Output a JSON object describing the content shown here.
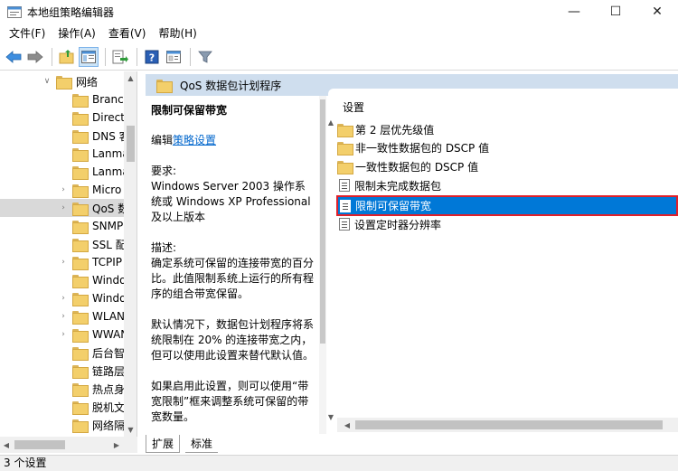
{
  "window": {
    "title": "本地组策略编辑器",
    "minimize_glyph": "—",
    "maximize_glyph": "☐",
    "close_glyph": "✕"
  },
  "menu": [
    {
      "label": "文件(F)"
    },
    {
      "label": "操作(A)"
    },
    {
      "label": "查看(V)"
    },
    {
      "label": "帮助(H)"
    }
  ],
  "toolbar": {
    "icons": [
      "back-arrow-icon",
      "forward-arrow-icon",
      "up-folder-icon",
      "show-hide-tree-icon",
      "export-list-icon",
      "help-icon",
      "properties-icon",
      "filter-icon"
    ]
  },
  "tree": {
    "items": [
      {
        "label": "网络",
        "expanded": true,
        "arrow": "∨"
      },
      {
        "label": "Branch",
        "arrow": ""
      },
      {
        "label": "Direct",
        "arrow": ""
      },
      {
        "label": "DNS 客",
        "arrow": ""
      },
      {
        "label": "Lanma",
        "arrow": ""
      },
      {
        "label": "Lanma",
        "arrow": ""
      },
      {
        "label": "Micro",
        "arrow": "›"
      },
      {
        "label": "QoS 数",
        "arrow": "›",
        "selected": true
      },
      {
        "label": "SNMP",
        "arrow": ""
      },
      {
        "label": "SSL 配",
        "arrow": ""
      },
      {
        "label": "TCPIP",
        "arrow": "›"
      },
      {
        "label": "Windo",
        "arrow": ""
      },
      {
        "label": "Windo",
        "arrow": "›"
      },
      {
        "label": "WLAN",
        "arrow": "›"
      },
      {
        "label": "WWAN",
        "arrow": "›"
      },
      {
        "label": "后台智",
        "arrow": ""
      },
      {
        "label": "链路层",
        "arrow": ""
      },
      {
        "label": "热点身",
        "arrow": ""
      },
      {
        "label": "脱机文",
        "arrow": ""
      },
      {
        "label": "网络隔",
        "arrow": ""
      }
    ]
  },
  "section": {
    "title": "QoS 数据包计划程序"
  },
  "description": {
    "title": "限制可保留带宽",
    "edit_prefix": "编辑",
    "edit_link": "策略设置",
    "requirements_label": "要求:",
    "requirements_text": "Windows Server 2003 操作系统或 Windows XP Professional 及以上版本",
    "desc_label": "描述:",
    "desc_text": "确定系统可保留的连接带宽的百分比。此值限制系统上运行的所有程序的组合带宽保留。",
    "default_text": "默认情况下，数据包计划程序将系统限制在 20% 的连接带宽之内，但可以使用此设置来替代默认值。",
    "enabled_text": "如果启用此设置，则可以使用“带宽限制”框来调整系统可保留的带宽数量。"
  },
  "list": {
    "header": "设置",
    "items": [
      {
        "label": "第 2 层优先级值",
        "type": "folder"
      },
      {
        "label": "非一致性数据包的 DSCP 值",
        "type": "folder"
      },
      {
        "label": "一致性数据包的 DSCP 值",
        "type": "folder"
      },
      {
        "label": "限制未完成数据包",
        "type": "setting"
      },
      {
        "label": "限制可保留带宽",
        "type": "setting",
        "selected": true
      },
      {
        "label": "设置定时器分辨率",
        "type": "setting"
      }
    ]
  },
  "tabs": [
    {
      "label": "扩展",
      "active": true
    },
    {
      "label": "标准",
      "active": false
    }
  ],
  "status": {
    "text": "3 个设置"
  },
  "colors": {
    "header_band": "#cfdeee",
    "selection_blue": "#0078d7",
    "highlight_red": "#e0202a",
    "link": "#0066cc"
  }
}
